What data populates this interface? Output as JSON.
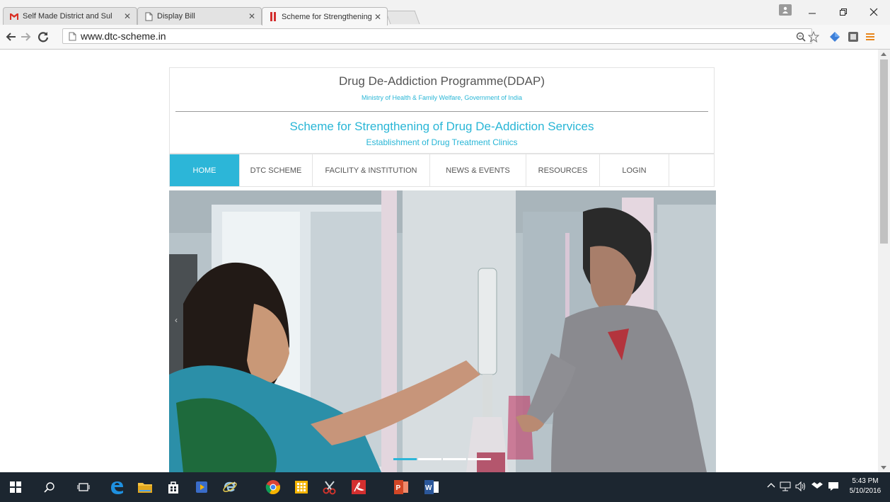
{
  "browser": {
    "tabs": [
      {
        "title": "Self Made District and Sul",
        "icon": "gmail-icon",
        "active": false
      },
      {
        "title": "Display Bill",
        "icon": "page-icon",
        "active": false
      },
      {
        "title": "Scheme for Strengthening",
        "icon": "site-favicon",
        "active": true
      }
    ],
    "url": "www.dtc-scheme.in"
  },
  "page": {
    "programme_title": "Drug De-Addiction Programme(DDAP)",
    "ministry": "Ministry of Health & Family Welfare, Government of India",
    "scheme_title": "Scheme for Strengthening of Drug De-Addiction Services",
    "scheme_subtitle": "Establishment of Drug Treatment Clinics",
    "menu": [
      {
        "label": "HOME",
        "active": true
      },
      {
        "label": "DTC SCHEME",
        "active": false
      },
      {
        "label": "FACILITY & INSTITUTION",
        "active": false
      },
      {
        "label": "NEWS & EVENTS",
        "active": false
      },
      {
        "label": "RESOURCES",
        "active": false
      },
      {
        "label": "LOGIN",
        "active": false
      },
      {
        "label": "",
        "active": false
      }
    ],
    "slider": {
      "slide_count": 4,
      "active_index": 0,
      "prev_arrow": "‹"
    },
    "accent_color": "#2cb6d8"
  },
  "taskbar": {
    "apps": [
      "start-icon",
      "search-icon",
      "task-view-icon",
      "edge-icon",
      "file-explorer-icon",
      "store-icon",
      "media-player-icon",
      "ie-icon",
      "chrome-icon",
      "calculator-icon",
      "snipping-tool-icon",
      "acrobat-icon",
      "powerpoint-icon",
      "word-icon"
    ],
    "time": "5:43 PM",
    "date": "5/10/2016"
  }
}
